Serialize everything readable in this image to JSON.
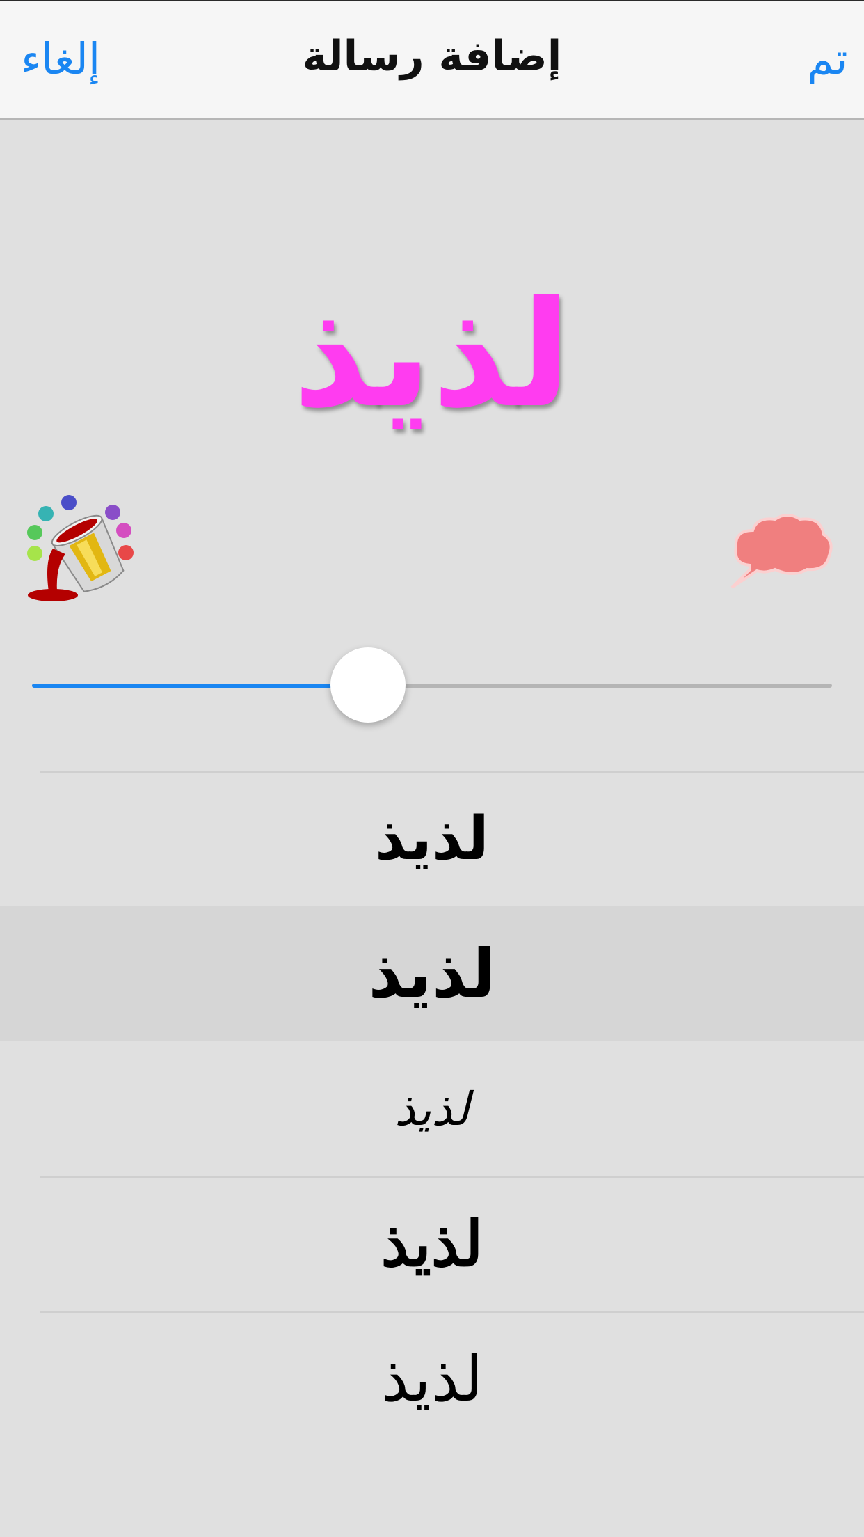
{
  "nav": {
    "title": "إضافة رسالة",
    "done_label": "تم",
    "cancel_label": "إلغاء"
  },
  "preview": {
    "text": "لذيذ",
    "color": "#ff3cf0"
  },
  "tools": {
    "paint_icon": "paint-bucket-icon",
    "bubble_icon": "speech-bubble-icon"
  },
  "slider": {
    "value": 0.42,
    "accent": "#1a86f2"
  },
  "fonts": {
    "items": [
      {
        "label": "لذيذ"
      },
      {
        "label": "لذيذ"
      },
      {
        "label": "لذيذ"
      },
      {
        "label": "لذيذ"
      },
      {
        "label": "لذيذ"
      }
    ],
    "selected_index": 1
  }
}
